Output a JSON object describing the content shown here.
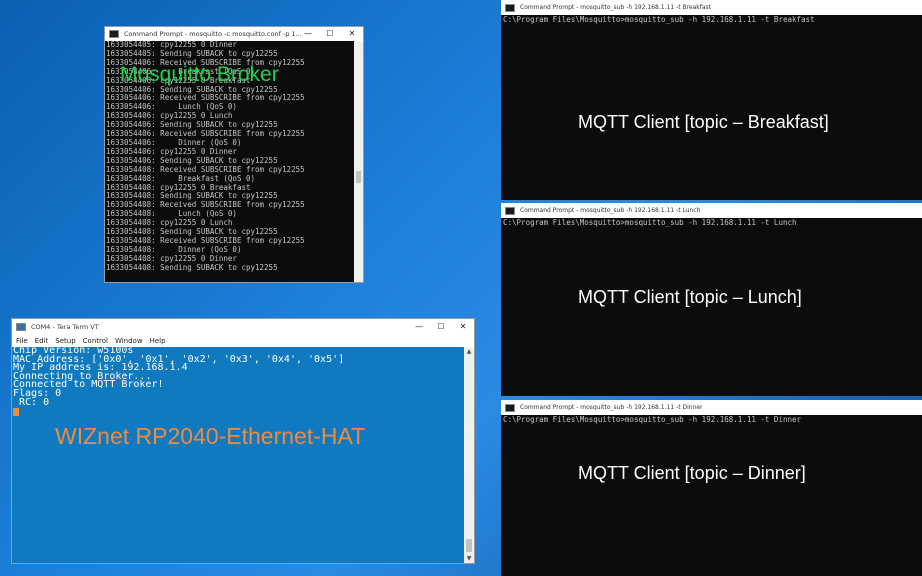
{
  "broker_window": {
    "title": "Command Prompt - mosquitto  -c mosquitto.conf -p 1...",
    "overlay_label": "Mosquitto Broker",
    "lines": [
      "1633054405: cpy12255 0 Dinner",
      "1633054405: Sending SUBACK to cpy12255",
      "1633054406: Received SUBSCRIBE from cpy12255",
      "1633054406:     Breakfast (QoS 0)",
      "1633054406: cpy12255 0 Breakfast",
      "1633054406: Sending SUBACK to cpy12255",
      "1633054406: Received SUBSCRIBE from cpy12255",
      "1633054406:     Lunch (QoS 0)",
      "1633054406: cpy12255 0 Lunch",
      "1633054406: Sending SUBACK to cpy12255",
      "1633054406: Received SUBSCRIBE from cpy12255",
      "1633054406:     Dinner (QoS 0)",
      "1633054406: cpy12255 0 Dinner",
      "1633054406: Sending SUBACK to cpy12255",
      "1633054408: Received SUBSCRIBE from cpy12255",
      "1633054408:     Breakfast (QoS 0)",
      "1633054408: cpy12255 0 Breakfast",
      "1633054408: Sending SUBACK to cpy12255",
      "1633054408: Received SUBSCRIBE from cpy12255",
      "1633054408:     Lunch (QoS 0)",
      "1633054408: cpy12255 0 Lunch",
      "1633054408: Sending SUBACK to cpy12255",
      "1633054408: Received SUBSCRIBE from cpy12255",
      "1633054408:     Dinner (QoS 0)",
      "1633054408: cpy12255 0 Dinner",
      "1633054408: Sending SUBACK to cpy12255"
    ]
  },
  "teraterm_window": {
    "title": "COM4 - Tera Term VT",
    "menu": [
      "File",
      "Edit",
      "Setup",
      "Control",
      "Window",
      "Help"
    ],
    "overlay_label": "WIZnet RP2040-Ethernet-HAT",
    "lines": [
      "Chip Version: w5100s",
      "MAC Address: ['0x0', '0x1', '0x2', '0x3', '0x4', '0x5']",
      "My IP address is: 192.168.1.4",
      "Connecting to Broker...",
      "Connected to MQTT Broker!",
      "Flags: 0",
      " RC: 0"
    ]
  },
  "client_windows": [
    {
      "title": "Command Prompt - mosquitto_sub  -h 192.168.1.11 -t Breakfast",
      "command": "C:\\Program Files\\Mosquitto>mosquitto_sub -h 192.168.1.11 -t Breakfast",
      "overlay_label": "MQTT Client [topic – Breakfast]"
    },
    {
      "title": "Command Prompt - mosquitto_sub  -h 192.168.1.11 -t Lunch",
      "command": "C:\\Program Files\\Mosquitto>mosquitto_sub -h 192.168.1.11 -t Lunch",
      "overlay_label": "MQTT Client [topic – Lunch]"
    },
    {
      "title": "Command Prompt - mosquitto_sub  -h 192.168.1.11 -t Dinner",
      "command": "C:\\Program Files\\Mosquitto>mosquitto_sub -h 192.168.1.11 -t Dinner",
      "overlay_label": "MQTT Client [topic – Dinner]"
    }
  ],
  "window_controls": {
    "minimize": "—",
    "maximize": "☐",
    "close": "✕"
  },
  "colors": {
    "broker_label": "#1fd14a",
    "teraterm_bg": "#0f7abf",
    "teraterm_label": "#f08a3c",
    "console_bg": "#0c0c0c"
  }
}
